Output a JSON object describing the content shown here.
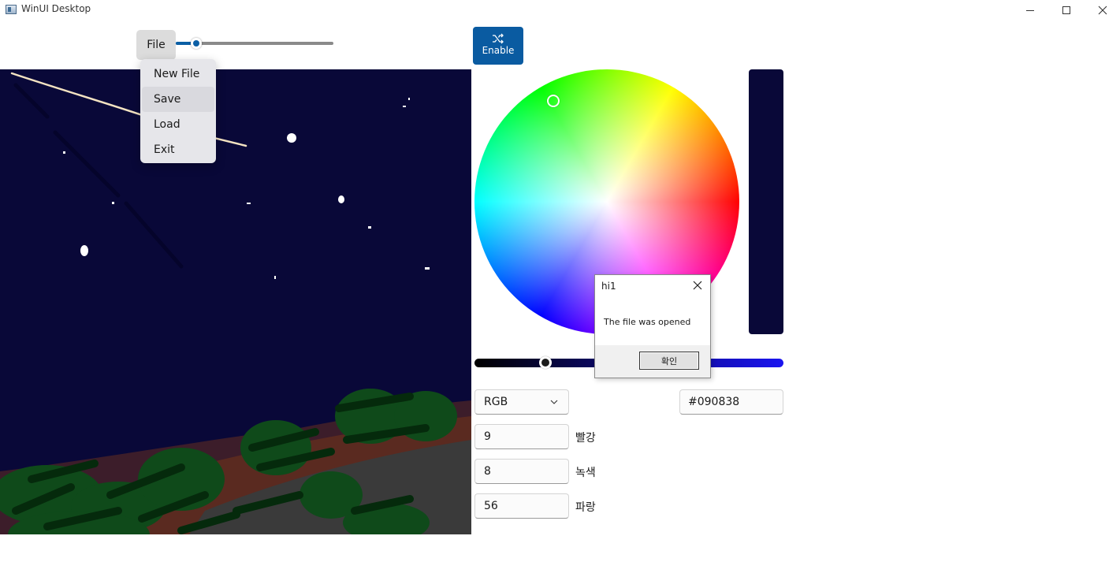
{
  "window": {
    "title": "WinUI Desktop"
  },
  "toolbar": {
    "file_label": "File",
    "brush_size": 0.1,
    "enable_label": "Enable",
    "enable_icon": "shuffle-icon"
  },
  "file_menu": {
    "items": [
      {
        "label": "New File"
      },
      {
        "label": "Save"
      },
      {
        "label": "Load"
      },
      {
        "label": "Exit"
      }
    ],
    "hovered": "Save"
  },
  "canvas": {
    "background": "#090838"
  },
  "color_picker": {
    "preview_color": "#090838",
    "value_level": 0.23,
    "mode": "RGB",
    "hex": "#090838",
    "channels": [
      {
        "value": "9",
        "label": "빨강"
      },
      {
        "value": "8",
        "label": "녹색"
      },
      {
        "value": "56",
        "label": "파랑"
      }
    ]
  },
  "dialog": {
    "title": "hi1",
    "message": "The file was opened",
    "ok_label": "확인"
  }
}
